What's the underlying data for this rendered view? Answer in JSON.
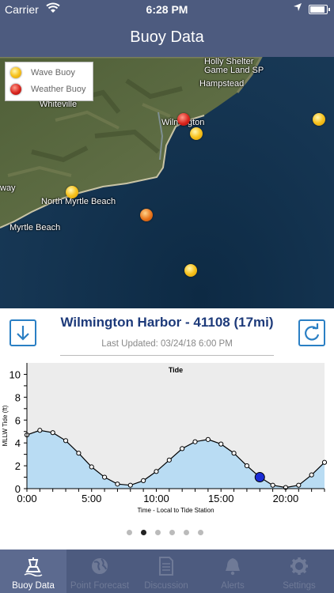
{
  "status": {
    "carrier": "Carrier",
    "time": "6:28 PM"
  },
  "nav": {
    "title": "Buoy Data"
  },
  "map": {
    "labels": {
      "holly": "Holly Shelter",
      "holly2": "Game Land SP",
      "hampstead": "Hampstead",
      "whiteville": "Whiteville",
      "wilmington": "Wilmington",
      "way": "way",
      "north_myrtle": "North Myrtle Beach",
      "myrtle": "Myrtle Beach"
    },
    "legend": {
      "wave": "Wave Buoy",
      "weather": "Weather Buoy"
    }
  },
  "station": {
    "title": "Wilmington Harbor - 41108 (17mi)",
    "updated": "Last Updated: 03/24/18 6:00 PM"
  },
  "chart_data": {
    "type": "line",
    "title": "Tide",
    "xlabel": "Time - Local to Tide Station",
    "ylabel": "MLLW Tide (ft)",
    "xlim": [
      0,
      23
    ],
    "ylim": [
      0,
      11
    ],
    "x_ticks": [
      "0:00",
      "5:00",
      "10:00",
      "15:00",
      "20:00"
    ],
    "y_ticks": [
      "0",
      "2",
      "4",
      "6",
      "8",
      "10"
    ],
    "series": [
      {
        "x": [
          0,
          1,
          2,
          3,
          4,
          5,
          6,
          7,
          8,
          9,
          10,
          11,
          12,
          13,
          14,
          15,
          16,
          17,
          18,
          19,
          20,
          21,
          22,
          23
        ],
        "values": [
          4.7,
          5.1,
          4.9,
          4.2,
          3.1,
          1.9,
          1.0,
          0.4,
          0.3,
          0.7,
          1.5,
          2.5,
          3.5,
          4.1,
          4.3,
          3.9,
          3.1,
          2.0,
          1.0,
          0.3,
          0.1,
          0.3,
          1.2,
          2.3
        ]
      }
    ],
    "current": {
      "x": 18,
      "y": 1.0
    },
    "colors": {
      "fill": "#b9dcf3",
      "line": "#000000",
      "marker": "#1a2cd6"
    },
    "grid": false
  },
  "pager": {
    "count": 6,
    "active": 1
  },
  "tabs": [
    {
      "label": "Buoy Data",
      "icon": "buoy-icon"
    },
    {
      "label": "Point Forecast",
      "icon": "globe-icon"
    },
    {
      "label": "Discussion",
      "icon": "document-icon"
    },
    {
      "label": "Alerts",
      "icon": "bell-icon"
    },
    {
      "label": "Settings",
      "icon": "gear-icon"
    }
  ],
  "colors": {
    "bar": "#4d5b7f",
    "accent": "#2a7fc4",
    "title": "#1d3a7a"
  }
}
